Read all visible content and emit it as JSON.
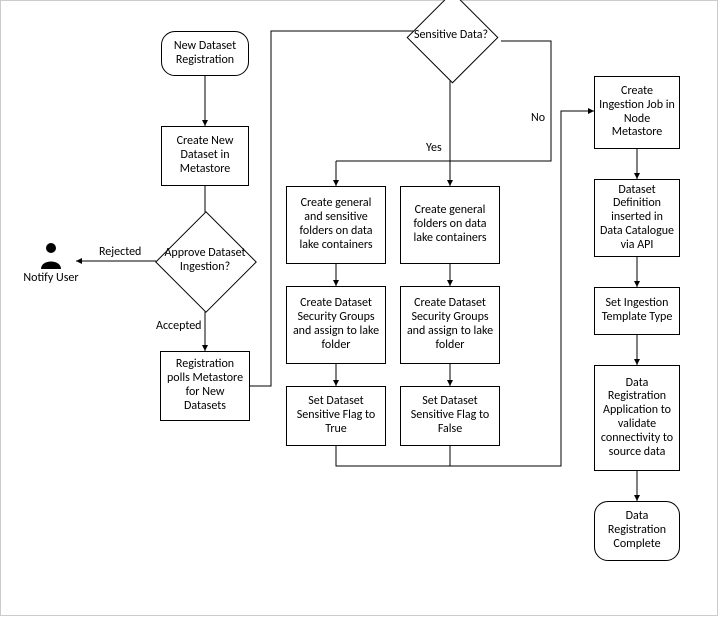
{
  "diagram": {
    "start": "New Dataset Registration",
    "createDataset": "Create New Dataset in Metastore",
    "approve": "Approve Dataset Ingestion?",
    "pollRegistration": "Registration polls Metastore for New Datasets",
    "notifyUser": "Notify User",
    "sensitive": "Sensitive Data?",
    "createBothFolders": "Create general and sensitive folders on data lake containers",
    "createGeneralFolders": "Create general folders on data lake containers",
    "securityGroups1": "Create Dataset Security Groups and assign to lake folder",
    "securityGroups2": "Create Dataset Security Groups and assign to lake folder",
    "flagTrue": "Set Dataset Sensitive Flag to True",
    "flagFalse": "Set Dataset Sensitive Flag to False",
    "createIngestionJob": "Create Ingestion Job in Node Metastore",
    "dataCatalogue": "Dataset Definition inserted in Data Catalogue via API",
    "templateType": "Set Ingestion Template Type",
    "validate": "Data Registration Application to validate connectivity to source data",
    "complete": "Data Registration Complete"
  },
  "labels": {
    "rejected": "Rejected",
    "accepted": "Accepted",
    "yes": "Yes",
    "no": "No"
  }
}
